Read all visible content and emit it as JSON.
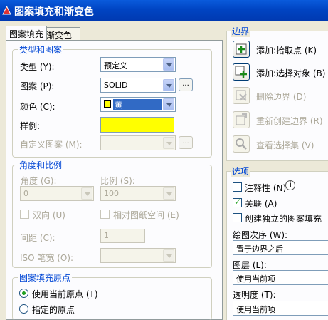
{
  "window": {
    "title": "图案填充和渐变色"
  },
  "tabs": [
    {
      "label": "图案填充",
      "active": true
    },
    {
      "label": "渐变色",
      "active": false
    }
  ],
  "type_and_pattern": {
    "title": "类型和图案",
    "type_label": "类型 (Y):",
    "type_value": "预定义",
    "pattern_label": "图案 (P):",
    "pattern_value": "SOLID",
    "color_label": "颜色 (C):",
    "color_value": "黄",
    "swatch_label": "样例:",
    "custom_label": "自定义图案 (M):",
    "ellipsis": "..."
  },
  "angle_scale": {
    "title": "角度和比例",
    "angle_label": "角度 (G):",
    "angle_value": "0",
    "scale_label": "比例 (S):",
    "scale_value": "100",
    "double_label": "双向 (U)",
    "relative_label": "相对图纸空间 (E)",
    "spacing_label": "间距 (C):",
    "spacing_value": "1",
    "iso_label": "ISO 笔宽 (O):"
  },
  "origin": {
    "title": "图案填充原点",
    "current_label": "使用当前原点 (T)",
    "specified_label": "指定的原点"
  },
  "boundary": {
    "title": "边界",
    "add_pick": "添加:拾取点 (K)",
    "add_select": "添加:选择对象 (B)",
    "remove": "删除边界 (D)",
    "recreate": "重新创建边界 (R)",
    "view": "查看选择集 (V)"
  },
  "options": {
    "title": "选项",
    "annotative": "注释性 (N)",
    "associative": "关联 (A)",
    "independent": "创建独立的图案填充",
    "draw_order_label": "绘图次序 (W):",
    "draw_order_value": "置于边界之后",
    "layer_label": "图层 (L):",
    "layer_value": "使用当前项",
    "transparency_label": "透明度 (T):",
    "transparency_value": "使用当前项"
  },
  "colors": {
    "accent": "#0046d5",
    "swatch": "#ffff00",
    "titlebar": "#0044c2"
  }
}
